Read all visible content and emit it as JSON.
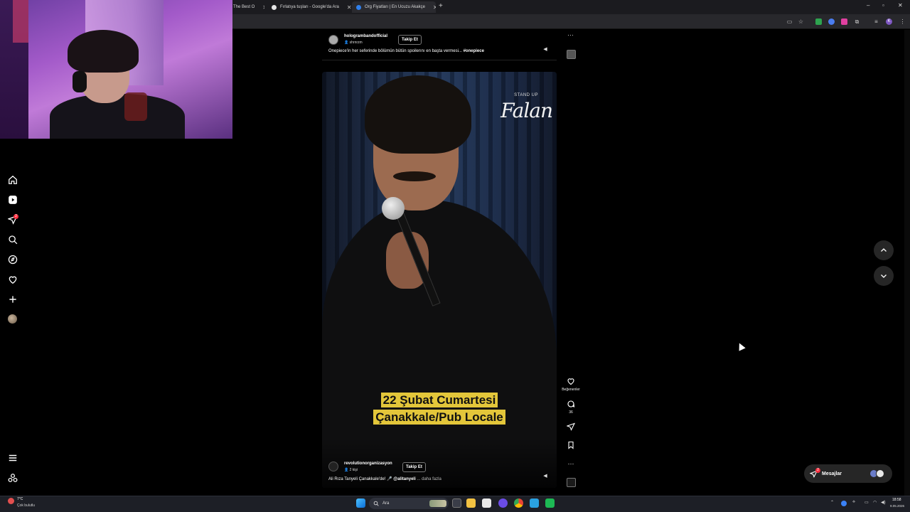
{
  "browser": {
    "tabs": [
      {
        "title": "The Best O",
        "favicon_color": "#c0392b"
      },
      {
        "title": "Fırlatıya tuşları - Google'da Ara",
        "favicon_color": "#e6e6e6"
      },
      {
        "title": "Org Fiyatları | En Ucuzu Akakçe",
        "favicon_color": "#2f80ed"
      }
    ],
    "new_tab_icon": "plus-icon",
    "profile_initial": "K"
  },
  "prev_post": {
    "username": "hologrambandofficial",
    "audio_line": "shrnrzm",
    "follow_label": "Takip Et",
    "caption_text": "Onepiece'in her seferinde bölümün bütün spoilerını en başta vermesi...",
    "caption_hashtag": "#onepiece"
  },
  "reel": {
    "brand_small": "STAND UP",
    "brand_big": "Falan",
    "overlay_line1": "22 Şubat Cumartesi",
    "overlay_line2": "Çanakkale/Pub Locale",
    "username": "revolutionorganizasyon",
    "audio_line": "2 kişi",
    "follow_label": "Takip Et",
    "caption_text": "Ali Rıza Tanyeli Çanakkale'de! 🎤",
    "caption_mention": "@alitanyeli",
    "caption_more": "... daha fazla",
    "likes_label": "Beğenenler",
    "comments_count": "36"
  },
  "nav": {
    "notification_count": "2"
  },
  "messages": {
    "label": "Mesajlar",
    "badge": "2"
  },
  "taskbar": {
    "temperature": "7°C",
    "weather_desc": "Çok bulutlu",
    "search_placeholder": "Ara",
    "time": "18:58",
    "date": "9.05.2026"
  },
  "colors": {
    "accent_red": "#ff3040",
    "overlay_yellow": "#e3c63a"
  }
}
